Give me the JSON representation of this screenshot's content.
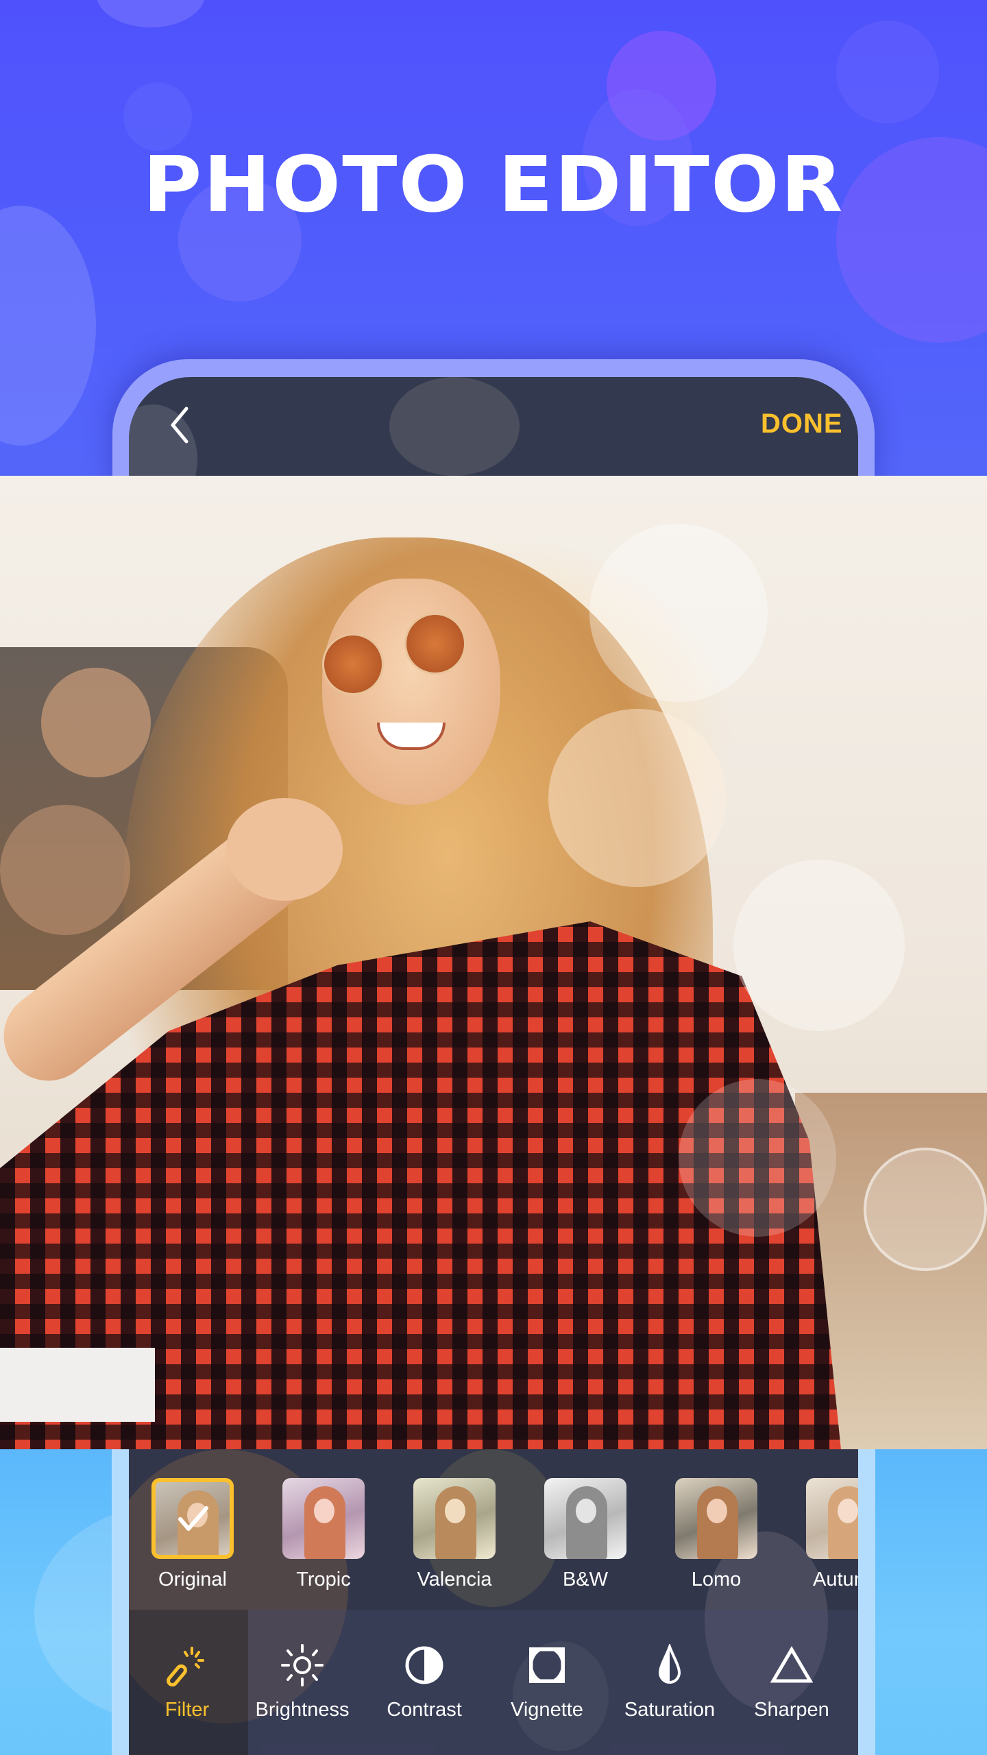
{
  "promo": {
    "title": "PHOTO EDITOR"
  },
  "header": {
    "back_icon": "chevron-left-icon",
    "done_label": "DONE"
  },
  "colors": {
    "accent": "#fbc02d",
    "top_background": "#5057fb",
    "bottom_background": "#6cc6fb",
    "panel": "#32364a",
    "frame": "#97a1fd"
  },
  "filters": {
    "selected": "Original",
    "items": [
      {
        "label": "Original",
        "selected": true
      },
      {
        "label": "Tropic",
        "selected": false
      },
      {
        "label": "Valencia",
        "selected": false
      },
      {
        "label": "B&W",
        "selected": false
      },
      {
        "label": "Lomo",
        "selected": false
      },
      {
        "label": "Autumn",
        "selected": false
      }
    ]
  },
  "tools": {
    "active": "Filter",
    "items": [
      {
        "label": "Filter",
        "icon": "magic-wand-icon",
        "active": true
      },
      {
        "label": "Brightness",
        "icon": "sun-icon",
        "active": false
      },
      {
        "label": "Contrast",
        "icon": "half-circle-icon",
        "active": false
      },
      {
        "label": "Vignette",
        "icon": "vignette-icon",
        "active": false
      },
      {
        "label": "Saturation",
        "icon": "droplet-icon",
        "active": false
      },
      {
        "label": "Sharpen",
        "icon": "triangle-icon",
        "active": false
      }
    ]
  }
}
